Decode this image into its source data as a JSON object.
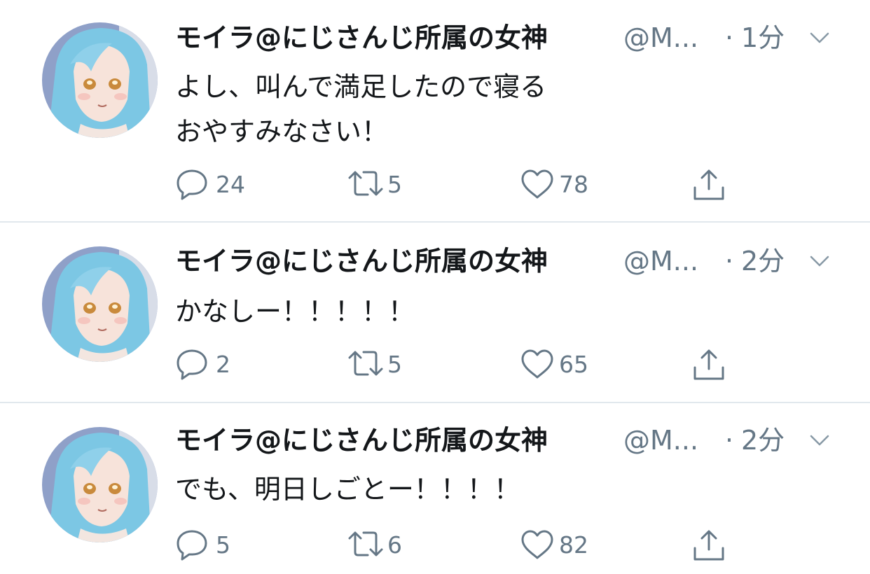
{
  "tweets": [
    {
      "display_name": "モイラ@にじさんじ所属の女神",
      "handle": "@M...",
      "separator": "·",
      "time": "1分",
      "text": "よし、叫んで満足したので寝る\nおやすみなさい！",
      "replies": "24",
      "retweets": "5",
      "likes": "78"
    },
    {
      "display_name": "モイラ@にじさんじ所属の女神",
      "handle": "@M...",
      "separator": "·",
      "time": "2分",
      "text": "かなしー！！！！！",
      "replies": "2",
      "retweets": "5",
      "likes": "65"
    },
    {
      "display_name": "モイラ@にじさんじ所属の女神",
      "handle": "@M...",
      "separator": "·",
      "time": "2分",
      "text": "でも、明日しごとー！！！！",
      "replies": "5",
      "retweets": "6",
      "likes": "82"
    }
  ],
  "icons": {
    "reply": "speech-bubble-icon",
    "retweet": "retweet-arrows-icon",
    "like": "heart-icon",
    "share": "share-upload-icon",
    "menu": "chevron-down-icon"
  },
  "colors": {
    "text_primary": "#14171a",
    "text_secondary": "#657786",
    "divider": "#e1e8ed",
    "avatar_hair": "#7fc9e6",
    "avatar_bg": "#8a9bc4"
  }
}
